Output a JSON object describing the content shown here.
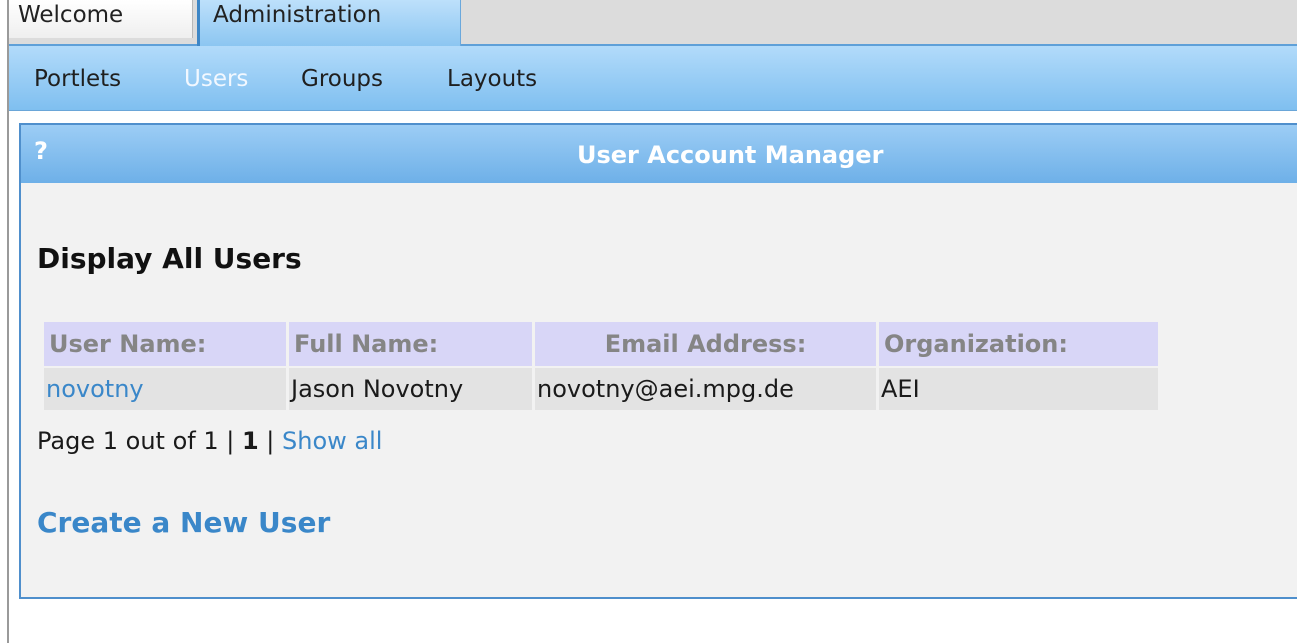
{
  "tabs": [
    {
      "label": "Welcome",
      "active": false
    },
    {
      "label": "Administration",
      "active": true
    }
  ],
  "subnav": [
    {
      "label": "Portlets",
      "active": false
    },
    {
      "label": "Users",
      "active": true
    },
    {
      "label": "Groups",
      "active": false
    },
    {
      "label": "Layouts",
      "active": false
    }
  ],
  "portlet": {
    "help_label": "?",
    "title": "User Account Manager",
    "heading": "Display All Users",
    "table": {
      "headers": [
        "User Name:",
        "Full Name:",
        "Email Address:",
        "Organization:"
      ],
      "rows": [
        {
          "user_name": "novotny",
          "full_name": "Jason Novotny",
          "email": "novotny@aei.mpg.de",
          "organization": "AEI"
        }
      ]
    },
    "pager": {
      "prefix": "Page 1 out of 1 |",
      "current": "1",
      "separator": "|",
      "show_all": "Show all"
    },
    "create_user_label": "Create a New User"
  },
  "colors": {
    "accent": "#6eb0e8",
    "link": "#3a87c9",
    "header_cell": "#d8d6f7",
    "row_cell": "#e3e3e3"
  }
}
